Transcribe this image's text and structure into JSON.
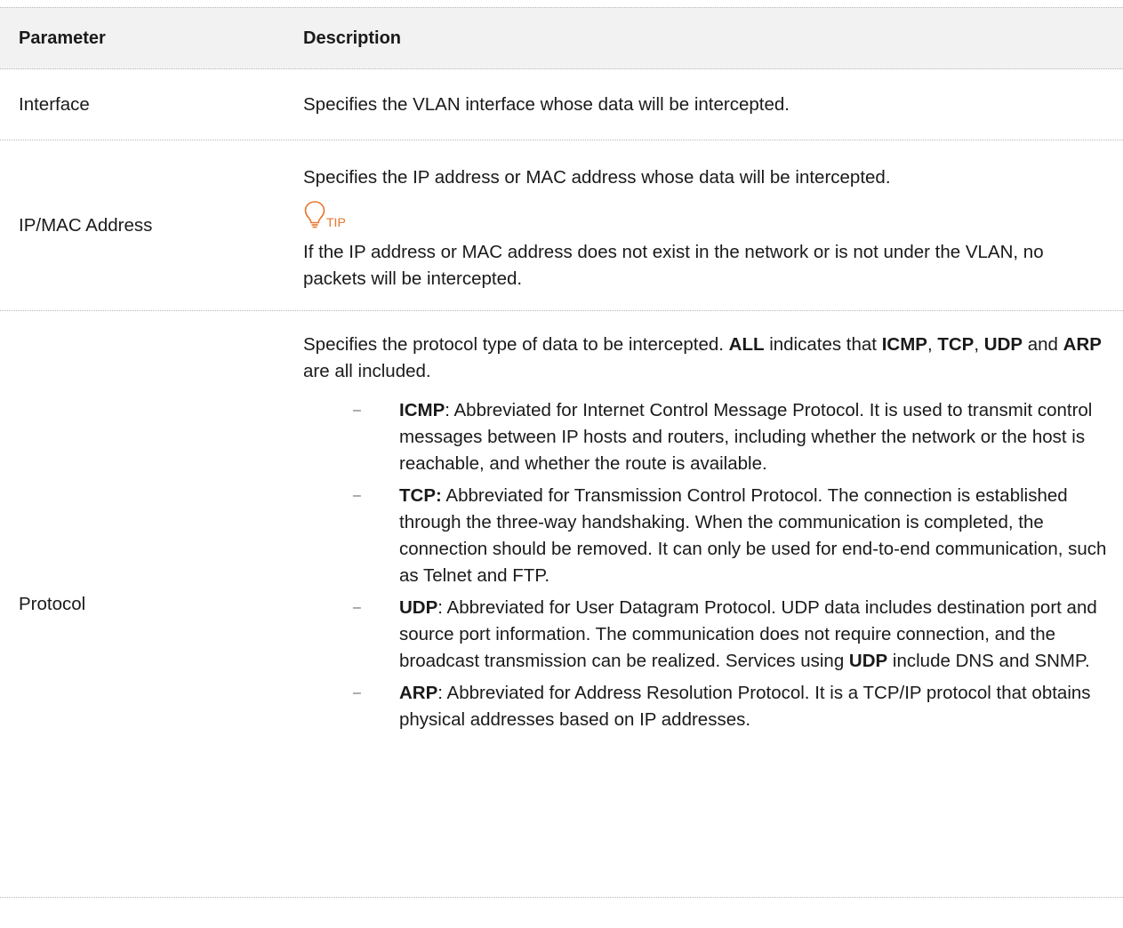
{
  "table": {
    "header": {
      "parameter": "Parameter",
      "description": "Description"
    },
    "rows": [
      {
        "param": "Interface",
        "desc": "Specifies the VLAN interface whose data will be intercepted."
      },
      {
        "param": "IP/MAC Address",
        "desc": "Specifies the IP address or MAC address whose data will be intercepted.",
        "tip_label": "TIP",
        "tip_text": "If the IP address or MAC address does not exist in the network or is not under the VLAN, no packets will be intercepted."
      },
      {
        "param": "Protocol",
        "intro": {
          "t1": "Specifies the protocol type of data to be intercepted. ",
          "b1": "ALL",
          "t2": " indicates that ",
          "b2": "ICMP",
          "t3": ", ",
          "b3": "TCP",
          "t4": ", ",
          "b4": "UDP",
          "t5": " and ",
          "b5": "ARP",
          "t6": " are all included."
        },
        "items": [
          {
            "dash": "–",
            "term": "ICMP",
            "text": ": Abbreviated for Internet Control Message Protocol. It is used to transmit control messages between IP hosts and routers, including whether the network or the host is reachable, and whether the route is available."
          },
          {
            "dash": "–",
            "term": "TCP:",
            "text": " Abbreviated for Transmission Control Protocol. The connection is established through the three-way handshaking. When the communication is completed, the connection should be removed. It can only be used for end-to-end communication, such as Telnet and FTP."
          },
          {
            "dash": "–",
            "term": "UDP",
            "text": ": Abbreviated for User Datagram Protocol. UDP data includes destination port and source port information. The communication does not require connection, and the broadcast transmission can be realized. Services using ",
            "term2": "UDP",
            "text2": " include DNS and SNMP."
          },
          {
            "dash": "–",
            "term": "ARP",
            "text": ": Abbreviated for Address Resolution Protocol. It is a TCP/IP protocol that obtains physical addresses based on IP addresses."
          }
        ]
      }
    ]
  },
  "colors": {
    "header_bg": "#f2f2f2",
    "tip_orange": "#e8762c",
    "divider": "#b8b8b8"
  },
  "icons": {
    "tip": "lightbulb-icon"
  }
}
